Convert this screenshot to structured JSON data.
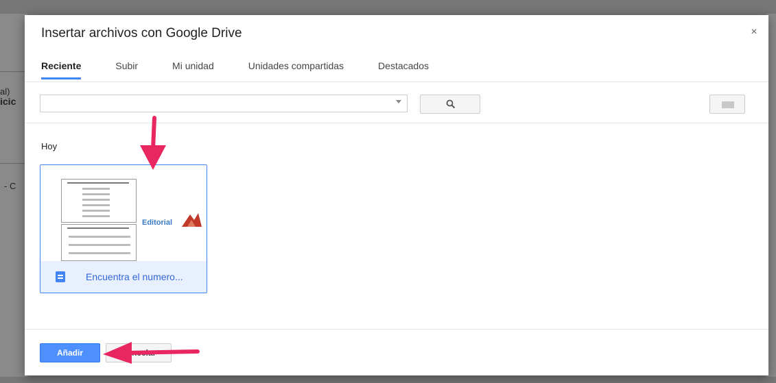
{
  "background": {
    "text_line1": "al)",
    "text_line2": "icic",
    "text_line3": "- C"
  },
  "dialog": {
    "title": "Insertar archivos con Google Drive",
    "close_label": "×",
    "tabs": [
      {
        "label": "Reciente",
        "active": true
      },
      {
        "label": "Subir",
        "active": false
      },
      {
        "label": "Mi unidad",
        "active": false
      },
      {
        "label": "Unidades compartidas",
        "active": false
      },
      {
        "label": "Destacados",
        "active": false
      }
    ],
    "search": {
      "value": "",
      "placeholder": ""
    },
    "section_label": "Hoy",
    "file": {
      "name": "Encuentra el numero...",
      "thumbnail_brand": "Editorial"
    },
    "buttons": {
      "add": "Añadir",
      "cancel": "Cancelar"
    }
  },
  "colors": {
    "accent": "#4285f4",
    "primary_button": "#4d90fe",
    "annotation_arrow": "#e8265f"
  }
}
